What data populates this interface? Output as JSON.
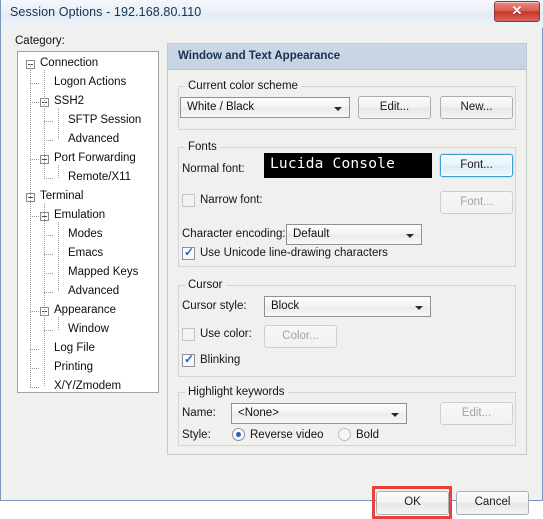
{
  "window": {
    "title": "Session Options - 192.168.80.110",
    "close_glyph": "✕",
    "category_label": "Category:"
  },
  "tree": {
    "items": [
      {
        "label": "Connection",
        "depth": 0,
        "toggle": "minus"
      },
      {
        "label": "Logon Actions",
        "depth": 1,
        "toggle": "none"
      },
      {
        "label": "SSH2",
        "depth": 1,
        "toggle": "minus"
      },
      {
        "label": "SFTP Session",
        "depth": 2,
        "toggle": "none"
      },
      {
        "label": "Advanced",
        "depth": 2,
        "toggle": "none"
      },
      {
        "label": "Port Forwarding",
        "depth": 1,
        "toggle": "minus"
      },
      {
        "label": "Remote/X11",
        "depth": 2,
        "toggle": "none"
      },
      {
        "label": "Terminal",
        "depth": 0,
        "toggle": "minus"
      },
      {
        "label": "Emulation",
        "depth": 1,
        "toggle": "minus"
      },
      {
        "label": "Modes",
        "depth": 2,
        "toggle": "none"
      },
      {
        "label": "Emacs",
        "depth": 2,
        "toggle": "none"
      },
      {
        "label": "Mapped Keys",
        "depth": 2,
        "toggle": "none"
      },
      {
        "label": "Advanced",
        "depth": 2,
        "toggle": "none"
      },
      {
        "label": "Appearance",
        "depth": 1,
        "toggle": "minus"
      },
      {
        "label": "Window",
        "depth": 2,
        "toggle": "none"
      },
      {
        "label": "Log File",
        "depth": 1,
        "toggle": "none"
      },
      {
        "label": "Printing",
        "depth": 1,
        "toggle": "none"
      },
      {
        "label": "X/Y/Zmodem",
        "depth": 1,
        "toggle": "none"
      }
    ]
  },
  "pane": {
    "header": "Window and Text Appearance",
    "color_scheme": {
      "group_title": "Current color scheme",
      "value": "White / Black",
      "edit_label": "Edit...",
      "new_label": "New..."
    },
    "fonts": {
      "group_title": "Fonts",
      "normal_font_label": "Normal font:",
      "normal_font_preview": "Lucida Console",
      "normal_font_button": "Font...",
      "narrow_font_label": "Narrow font:",
      "narrow_font_button": "Font...",
      "encoding_label": "Character encoding:",
      "encoding_value": "Default",
      "unicode_label": "Use Unicode line-drawing characters"
    },
    "cursor": {
      "group_title": "Cursor",
      "style_label": "Cursor style:",
      "style_value": "Block",
      "use_color_label": "Use color:",
      "color_button": "Color...",
      "blinking_label": "Blinking"
    },
    "highlight": {
      "group_title": "Highlight keywords",
      "name_label": "Name:",
      "name_value": "<None>",
      "edit_label": "Edit...",
      "style_label": "Style:",
      "reverse_video_label": "Reverse video",
      "bold_label": "Bold"
    }
  },
  "footer": {
    "ok_label": "OK",
    "cancel_label": "Cancel"
  },
  "colors": {
    "accent": "#2a62b8",
    "header_bar": "#c8d4e4",
    "annotation": "#e8413a",
    "dialog_bg": "#f0f0ee",
    "preview_bg": "#000000",
    "preview_fg": "#ffffff"
  }
}
